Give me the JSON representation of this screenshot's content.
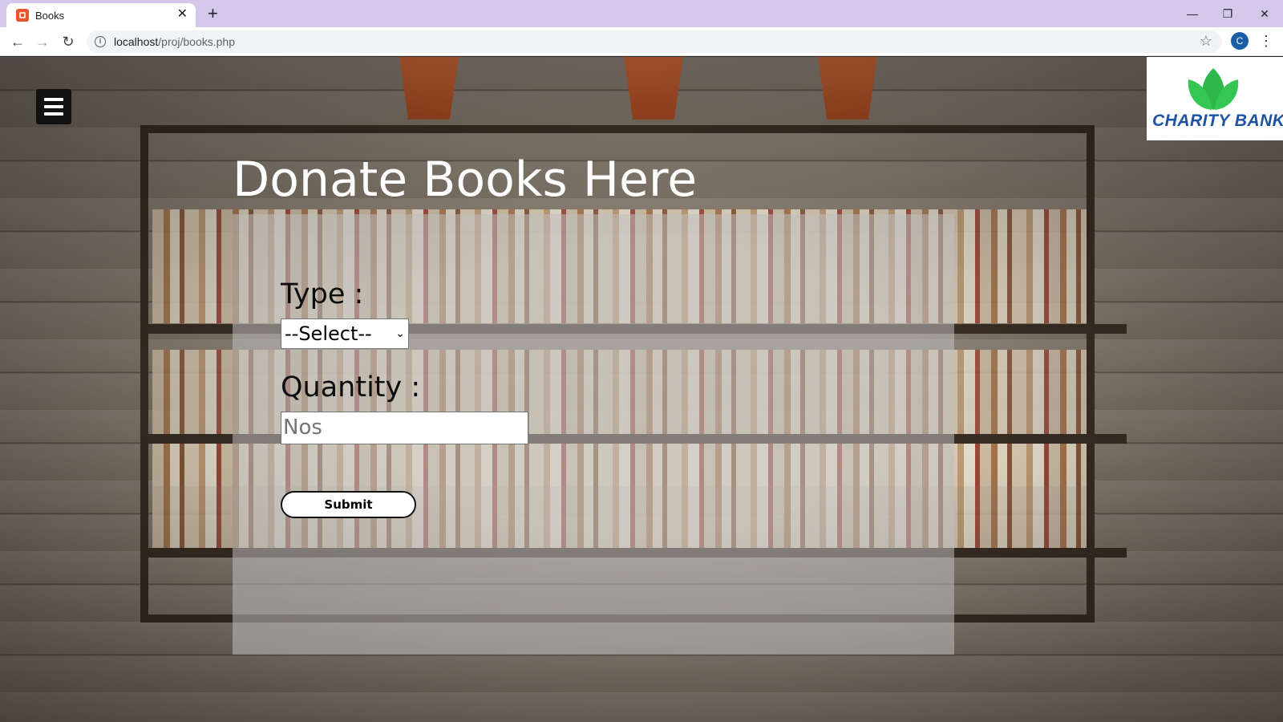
{
  "browser": {
    "tab_title": "Books",
    "tab_close": "✕",
    "new_tab": "+",
    "window_controls": {
      "minimize": "—",
      "restore": "❐",
      "close": "✕"
    },
    "nav": {
      "back": "←",
      "forward": "→",
      "reload": "↻"
    },
    "url_host": "localhost",
    "url_path": "/proj/books.php",
    "profile_initial": "C",
    "star": "☆",
    "menu": "⋮"
  },
  "page": {
    "logo_text": "CHARITY BANK",
    "title": "Donate Books Here",
    "form": {
      "type_label": "Type :",
      "type_selected": "--Select--",
      "quantity_label": "Quantity :",
      "quantity_placeholder": "Nos",
      "quantity_value": "",
      "submit_label": "Submit"
    }
  },
  "colors": {
    "tabbar_bg": "#d3c8ea",
    "logo_blue": "#1c53a3",
    "logo_green": "#2eb84a",
    "favicon": "#e7552c"
  },
  "icons": [
    "hamburger-menu-icon",
    "info-icon",
    "star-icon",
    "leaf-logo-icon",
    "kebab-menu-icon"
  ]
}
